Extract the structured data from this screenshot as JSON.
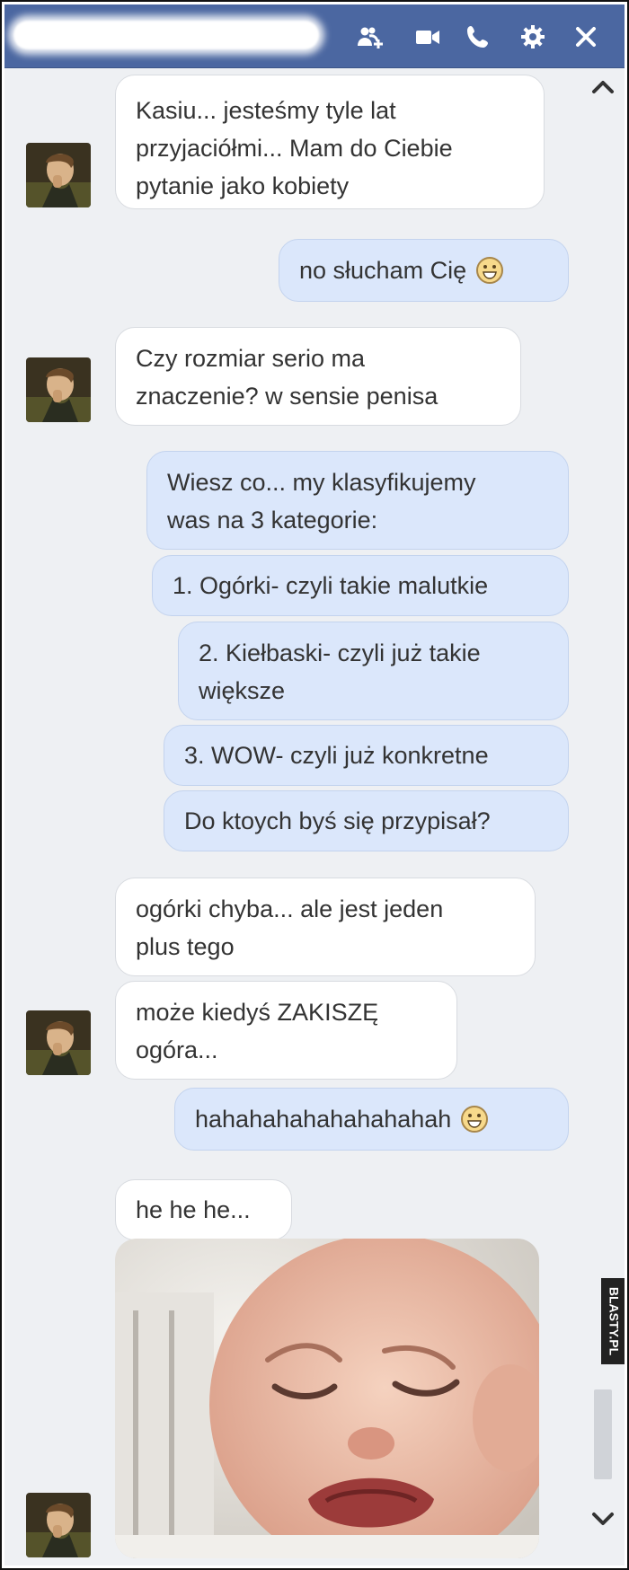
{
  "header": {
    "actions": [
      {
        "name": "add-people-icon"
      },
      {
        "name": "video-call-icon"
      },
      {
        "name": "voice-call-icon"
      },
      {
        "name": "settings-icon"
      },
      {
        "name": "close-icon"
      }
    ]
  },
  "messages": [
    {
      "from": "contact",
      "lines": [
        "Kasiu... jesteśmy tyle lat",
        "przyjaciółmi... Mam do Ciebie",
        "pytanie jako kobiety"
      ]
    },
    {
      "from": "me",
      "text": "no słucham Cię",
      "emoji": "smile-emoji"
    },
    {
      "from": "contact",
      "lines": [
        "Czy rozmiar serio ma",
        "znaczenie? w sensie penisa"
      ]
    },
    {
      "from": "me",
      "lines": [
        "Wiesz co... my klasyfikujemy",
        "was na 3 kategorie:"
      ]
    },
    {
      "from": "me",
      "text": "1. Ogórki- czyli takie malutkie"
    },
    {
      "from": "me",
      "lines": [
        "2. Kiełbaski- czyli już takie",
        "większe"
      ]
    },
    {
      "from": "me",
      "text": "3. WOW- czyli już konkretne"
    },
    {
      "from": "me",
      "text": "Do ktoych byś się przypisał?"
    },
    {
      "from": "contact",
      "lines": [
        "ogórki chyba... ale jest jeden",
        "plus tego"
      ]
    },
    {
      "from": "contact",
      "lines": [
        "może kiedyś ZAKISZĘ",
        "ogóra..."
      ]
    },
    {
      "from": "me",
      "text": "hahahahahahahahahah",
      "emoji": "smile-emoji"
    },
    {
      "from": "contact",
      "text": "he he he..."
    },
    {
      "from": "contact",
      "image": "crying-baby-photo"
    }
  ],
  "watermark": "BLASTY.PL",
  "colors": {
    "header": "#4b67a1",
    "background": "#eef0f3",
    "my_bubble": "#dbe7fb",
    "their_bubble": "#ffffff"
  }
}
